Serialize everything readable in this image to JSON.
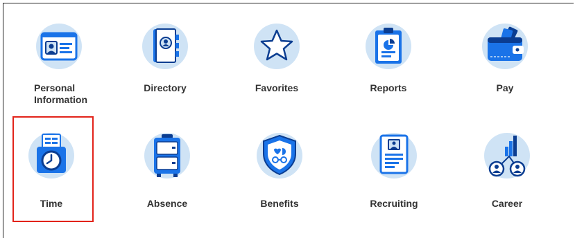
{
  "apps": [
    {
      "id": "personal-information",
      "label": "Personal Information",
      "icon": "id-card-icon"
    },
    {
      "id": "directory",
      "label": "Directory",
      "icon": "address-book-icon"
    },
    {
      "id": "favorites",
      "label": "Favorites",
      "icon": "star-icon"
    },
    {
      "id": "reports",
      "label": "Reports",
      "icon": "clipboard-chart-icon"
    },
    {
      "id": "pay",
      "label": "Pay",
      "icon": "wallet-icon"
    },
    {
      "id": "time",
      "label": "Time",
      "icon": "time-clock-icon"
    },
    {
      "id": "absence",
      "label": "Absence",
      "icon": "luggage-icon"
    },
    {
      "id": "benefits",
      "label": "Benefits",
      "icon": "shield-icon"
    },
    {
      "id": "recruiting",
      "label": "Recruiting",
      "icon": "resume-icon"
    },
    {
      "id": "career",
      "label": "Career",
      "icon": "career-growth-icon"
    }
  ],
  "highlighted_app": "Time",
  "colors": {
    "circle": "#cfe3f5",
    "icon_blue": "#1a73e8",
    "icon_dark": "#0b3d91",
    "icon_light": "#ffffff",
    "highlight": "#e2231a"
  }
}
